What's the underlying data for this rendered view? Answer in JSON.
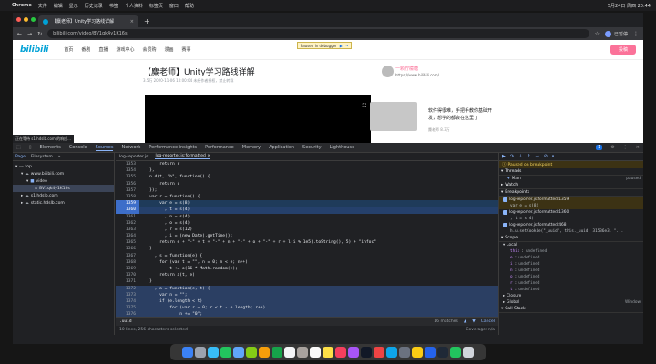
{
  "menubar": {
    "app": "Chrome",
    "items": [
      "文件",
      "编辑",
      "显示",
      "历史记录",
      "书签",
      "个人资料",
      "标签页",
      "窗口",
      "帮助"
    ],
    "status_right": "5月24日 周四 20:44"
  },
  "browser": {
    "tab_title": "【麋老师】Unity学习路线详解",
    "url": "bilibili.com/video/BV1qk4y1K16s",
    "profile": "已暂停"
  },
  "page": {
    "paused_text": "Paused in debugger",
    "nav": [
      "首页",
      "番剧",
      "直播",
      "游戏中心",
      "会员购",
      "漫画",
      "赛事"
    ],
    "upload_label": "投稿",
    "video_title": "【麋老师】Unity学习路线详解",
    "video_meta": "3.5万   2020-11-06 10:00:04   未经作者授权，禁止转载",
    "side_title": "一颗柠檬糖",
    "side_sub": "https://www.bilibili.com/...",
    "side_item_title": "软件得很难，手把手教你基础开发，想学的都会在这里了",
    "side_item_sub": "麋老师   8.3万",
    "tooltip": "正在等待 s1.hdslb.com 的响应..."
  },
  "devtools": {
    "tabs": [
      "Elements",
      "Console",
      "Sources",
      "Network",
      "Performance insights",
      "Performance",
      "Memory",
      "Application",
      "Security",
      "Lighthouse"
    ],
    "active_tab": "Sources",
    "badge": "1",
    "left_tabs": [
      "Page",
      "Filesystem"
    ],
    "tree": [
      {
        "label": "top",
        "indent": 0,
        "icon": "frame"
      },
      {
        "label": "www.bilibili.com",
        "indent": 1,
        "icon": "cloud"
      },
      {
        "label": "video",
        "indent": 2,
        "icon": "folder"
      },
      {
        "label": "BV1qk4y1K16s",
        "indent": 3,
        "icon": "file"
      },
      {
        "label": "s1.hdslb.com",
        "indent": 1,
        "icon": "cloud"
      },
      {
        "label": "static.hdslb.com",
        "indent": 1,
        "icon": "cloud"
      }
    ],
    "editor_tabs": [
      "log-reporter.js",
      "log-reporter.js:formatted"
    ],
    "code": [
      {
        "n": "1353",
        "t": "        return r"
      },
      {
        "n": "1354",
        "t": "    },"
      },
      {
        "n": "1355",
        "t": "    n.d(t, \"b\", function() {"
      },
      {
        "n": "1356",
        "t": "        return c"
      },
      {
        "n": "1357",
        "t": "    });"
      },
      {
        "n": "1358",
        "t": "    var r = function() {"
      },
      {
        "n": "1359",
        "t": "        var e = s(8)"
      },
      {
        "n": "1360",
        "t": "          , t = s(4)"
      },
      {
        "n": "1361",
        "t": "          , n = s(4)"
      },
      {
        "n": "1362",
        "t": "          , o = s(4)"
      },
      {
        "n": "1363",
        "t": "          , r = s(12)"
      },
      {
        "n": "1364",
        "t": "          , i = (new Date).getTime();"
      },
      {
        "n": "1365",
        "t": "        return e + \"-\" + t + \"-\" + n + \"-\" + o + \"-\" + r + l(i % 1e5).toString(), 5) + \"infoc\""
      },
      {
        "n": "1366",
        "t": "    }"
      },
      {
        "n": "1367",
        "t": "      , s = function(e) {"
      },
      {
        "n": "1368",
        "t": "        for (var t = \"\", n = 0; n < e; n++)"
      },
      {
        "n": "1369",
        "t": "            t += o(16 * Math.random());"
      },
      {
        "n": "1370",
        "t": "        return a(t, e)"
      },
      {
        "n": "1371",
        "t": "    }"
      },
      {
        "n": "1372",
        "t": "      , a = function(e, t) {"
      },
      {
        "n": "1373",
        "t": "        var n = \"\";"
      },
      {
        "n": "1374",
        "t": "        if (e.length < t)"
      },
      {
        "n": "1375",
        "t": "            for (var r = 0; r < t - e.length; r++)"
      },
      {
        "n": "1376",
        "t": "                n += \"0\";"
      },
      {
        "n": "1377",
        "t": "        return n + e"
      },
      {
        "n": "1378",
        "t": "    }"
      },
      {
        "n": "1379",
        "t": "      , o = function(e) {"
      },
      {
        "n": "1380",
        "t": "        return Math.ceil(e).toString(16).toUpperCase()"
      },
      {
        "n": "1381",
        "t": "    }"
      }
    ],
    "search_query": ".uuid",
    "search_count": "16 matches",
    "cancel_label": "Cancel",
    "status_left": "10 lines, 256 characters selected",
    "status_right": "Coverage: n/a",
    "paused_banner": "Paused on breakpoint",
    "threads_label": "Threads",
    "thread_main": "Main",
    "thread_state": "paused",
    "watch_label": "Watch",
    "breakpoints_label": "Breakpoints",
    "breakpoints": [
      {
        "file": "log-reporter.js:formatted:1359",
        "code": "var e = s(8)",
        "active": true
      },
      {
        "file": "log-reporter.js:formatted:1360",
        "code": ", t = s(4)",
        "active": false
      },
      {
        "file": "log-reporter.js:formatted:468",
        "code": "h.u.setCookie(\"_uuid\", this._uuid, 31536e3, \"...",
        "active": false
      }
    ],
    "scope_label": "Scope",
    "local_label": "Local",
    "scope": [
      {
        "k": "this",
        "v": "undefined"
      },
      {
        "k": "e",
        "v": "undefined"
      },
      {
        "k": "i",
        "v": "undefined"
      },
      {
        "k": "n",
        "v": "undefined"
      },
      {
        "k": "o",
        "v": "undefined"
      },
      {
        "k": "r",
        "v": "undefined"
      },
      {
        "k": "t",
        "v": "undefined"
      }
    ],
    "closure_label": "Closure",
    "global_label": "Global",
    "global_value": "Window",
    "callstack_label": "Call Stack"
  },
  "colors": {
    "bili_blue": "#00a1d6",
    "bili_pink": "#fb7299",
    "devtools_bg": "#202124",
    "accent": "#8ab4f8"
  }
}
